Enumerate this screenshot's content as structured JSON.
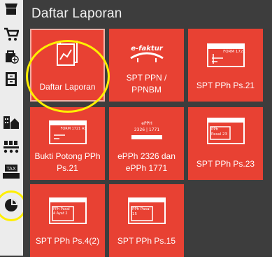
{
  "page": {
    "title": "Daftar Laporan"
  },
  "tiles": [
    {
      "label": "Daftar Laporan",
      "icon": "report-document-icon"
    },
    {
      "label": "SPT PPN / PPNBM",
      "icon": "efaktur-logo-icon",
      "brand": "e-faktur"
    },
    {
      "label": "SPT PPh Ps.21",
      "icon": "form-1721-icon",
      "form": "FORM 1721"
    },
    {
      "label": "Bukti Potong PPh Ps.21",
      "icon": "form-1721-a1-icon",
      "form": "FORM 1721 A1"
    },
    {
      "label": "ePPh 2326 dan ePPh 1771",
      "icon": "epph-icon",
      "line1": "ePPH",
      "line2": "2326 | 1771"
    },
    {
      "label": "SPT PPh Ps.23",
      "icon": "pph-pasal-23-icon",
      "form": "PPh Pasal 23"
    },
    {
      "label": "SPT PPh Ps.4(2)",
      "icon": "pph-pasal-4-ayat-2-icon",
      "form": "PPh Pasal 4 Ayat 2"
    },
    {
      "label": "SPT PPh Ps.15",
      "icon": "pph-pasal-15-icon",
      "form": "PPh Pasal 15"
    }
  ],
  "sidebar": [
    "shop-icon",
    "cart-icon",
    "bag-add-icon",
    "cabinet-icon",
    "building-house-icon",
    "conveyor-icon",
    "tax-icon",
    "pie-chart-icon"
  ],
  "colors": {
    "tile": "#e84133",
    "highlight": "#ffef00",
    "background": "#3d3d3d",
    "sidebar": "#ececec"
  }
}
